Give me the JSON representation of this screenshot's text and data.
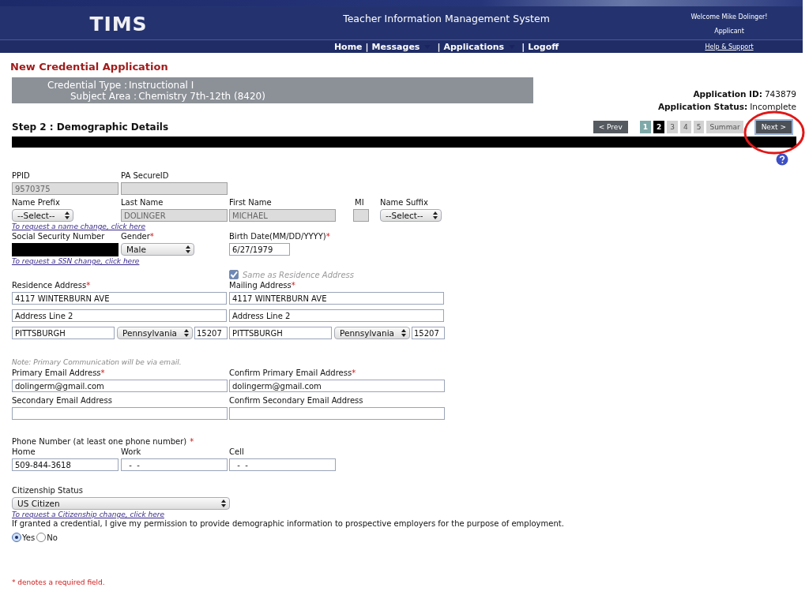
{
  "header": {
    "title": "TIMS",
    "subtitle": "Teacher Information Management System",
    "welcome": "Welcome Mike Dolinger!",
    "role": "Applicant",
    "help_link": "Help & Support",
    "separator": "|",
    "nav": [
      {
        "label": "Home",
        "has_menu": false
      },
      {
        "label": "Messages",
        "has_menu": true
      },
      {
        "label": "Applications",
        "has_menu": true
      },
      {
        "label": "Logoff",
        "has_menu": false
      }
    ]
  },
  "page_title": "New Credential Application",
  "credential": {
    "type_label": "Credential Type :",
    "type_value": "Instructional I",
    "subject_label": "Subject Area :",
    "subject_value": "Chemistry 7th-12th (8420)"
  },
  "application": {
    "id_label": "Application ID:",
    "id_value": "743879",
    "status_label": "Application Status:",
    "status_value": "Incomplete"
  },
  "step_title": "Step 2 : Demographic Details",
  "prev_button": "< Prev",
  "steps": [
    {
      "label": "1",
      "done": true,
      "selected": false
    },
    {
      "label": "2",
      "done": false,
      "selected": true
    },
    {
      "label": "3",
      "done": false,
      "selected": false
    },
    {
      "label": "4",
      "done": false,
      "selected": false
    },
    {
      "label": "5",
      "done": false,
      "selected": false
    },
    {
      "label": "Summar",
      "done": false,
      "selected": false
    }
  ],
  "next_button": "Next >",
  "annotation": {
    "kind": "circle"
  },
  "required_mark": "*",
  "form": {
    "ppid": {
      "label": "PPID",
      "kind": "text",
      "value": "9570375",
      "required": false,
      "disabled": true
    },
    "secure_id": {
      "label": "PA SecureID",
      "kind": "text",
      "required": false,
      "disabled": true
    },
    "name_prefix": {
      "label": "Name Prefix",
      "kind": "select",
      "value": "--Select--",
      "required": false,
      "disabled": false
    },
    "last_name": {
      "label": "Last Name",
      "kind": "text",
      "value": "DOLINGER",
      "required": false,
      "disabled": true
    },
    "first_name": {
      "label": "First Name",
      "kind": "text",
      "value": "MICHAEL",
      "required": false,
      "disabled": true
    },
    "mi": {
      "label": "MI",
      "kind": "text",
      "required": false,
      "disabled": true
    },
    "name_suffix": {
      "label": "Name Suffix",
      "kind": "select",
      "value": "--Select--",
      "required": false,
      "disabled": false
    },
    "name_change_link": "To request a name change, click here",
    "ssn": {
      "label": "Social Security Number",
      "kind": "redacted",
      "required": false,
      "disabled": false
    },
    "gender": {
      "label": "Gender",
      "kind": "select",
      "value": "Male",
      "required": true,
      "disabled": false
    },
    "birth_date": {
      "label": "Birth Date(MM/DD/YYYY)",
      "kind": "text",
      "value": "6/27/1979",
      "required": true,
      "disabled": false
    },
    "ssn_change_link": "To request a SSN change, click here",
    "same_address": {
      "label": "Same as Residence Address",
      "checked": true
    },
    "residence": {
      "label": "Residence Address",
      "required": true,
      "line1": "4117 WINTERBURN AVE",
      "line2": "Address Line 2",
      "city": "PITTSBURGH",
      "state": "Pennsylvania",
      "zip": "15207"
    },
    "mailing": {
      "label": "Mailing Address",
      "required": true,
      "line1": "4117 WINTERBURN AVE",
      "line2": "Address Line 2",
      "city": "PITTSBURGH",
      "state": "Pennsylvania",
      "zip": "15207"
    },
    "email_note": "Note: Primary Communication will be via email.",
    "primary_email": {
      "label": "Primary Email Address",
      "kind": "text",
      "value": "dolingerm@gmail.com",
      "required": true,
      "disabled": false
    },
    "confirm_primary_email": {
      "label": "Confirm Primary Email Address",
      "kind": "text",
      "value": "dolingerm@gmail.com",
      "required": true,
      "disabled": false
    },
    "secondary_email": {
      "label": "Secondary Email Address",
      "kind": "text",
      "required": false,
      "disabled": false
    },
    "confirm_secondary_email": {
      "label": "Confirm Secondary Email Address",
      "kind": "text",
      "required": false,
      "disabled": false
    },
    "phone_label": "Phone Number (at least one phone number)",
    "phone_required": true,
    "home_phone": {
      "label": "Home",
      "kind": "text",
      "value": "509-844-3618",
      "required": false,
      "disabled": false
    },
    "work_phone": {
      "label": "Work",
      "kind": "text",
      "value": "  -  -",
      "required": false,
      "disabled": false
    },
    "cell_phone": {
      "label": "Cell",
      "kind": "text",
      "value": "  -  -",
      "required": false,
      "disabled": false
    },
    "citizenship": {
      "label": "Citizenship Status",
      "kind": "select",
      "value": "US Citizen",
      "required": false,
      "disabled": false
    },
    "citizenship_change_link": "To request a Citizenship change, click here",
    "permission_text": "If granted a credential, I give my permission to provide demographic information to prospective employers for the purpose of employment.",
    "permission_options": [
      {
        "label": "Yes",
        "selected": true
      },
      {
        "label": "No",
        "selected": false
      }
    ]
  },
  "required_note": "* denotes a required field."
}
